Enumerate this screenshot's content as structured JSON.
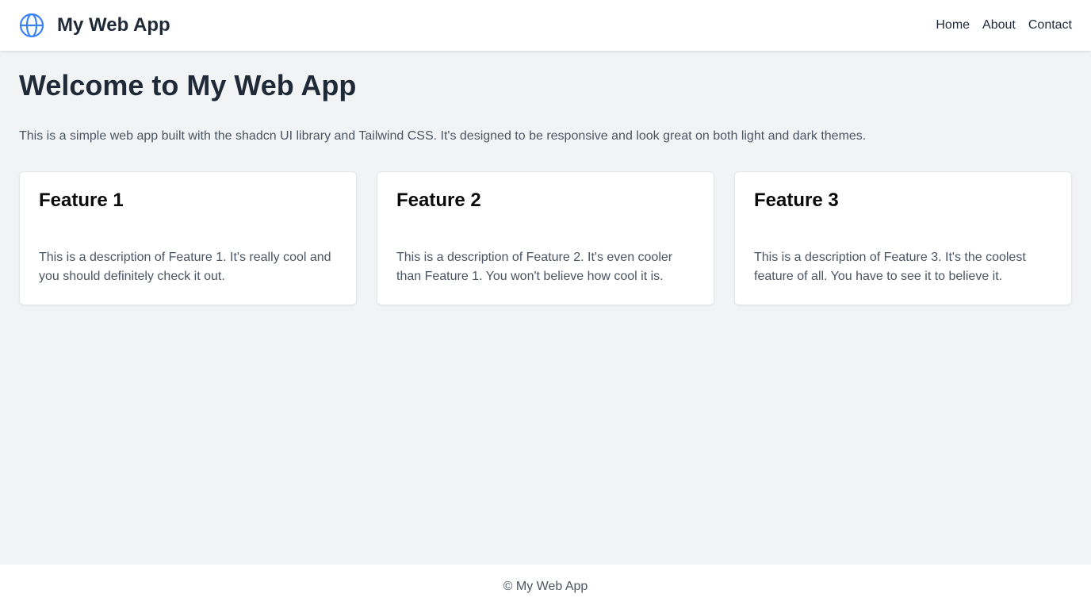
{
  "header": {
    "logo_icon": "globe-icon",
    "title": "My Web App",
    "nav": [
      {
        "label": "Home"
      },
      {
        "label": "About"
      },
      {
        "label": "Contact"
      }
    ]
  },
  "main": {
    "title": "Welcome to My Web App",
    "intro": "This is a simple web app built with the shadcn UI library and Tailwind CSS. It's designed to be responsive and look great on both light and dark themes.",
    "cards": [
      {
        "title": "Feature 1",
        "description": "This is a description of Feature 1. It's really cool and you should definitely check it out."
      },
      {
        "title": "Feature 2",
        "description": "This is a description of Feature 2. It's even cooler than Feature 1. You won't believe how cool it is."
      },
      {
        "title": "Feature 3",
        "description": "This is a description of Feature 3. It's the coolest feature of all. You have to see it to believe it."
      }
    ]
  },
  "footer": {
    "text": "© My Web App"
  },
  "colors": {
    "accent": "#3b82f6",
    "background": "#f2f3f5",
    "text_primary": "#1f2937",
    "text_secondary": "#4b5563"
  }
}
